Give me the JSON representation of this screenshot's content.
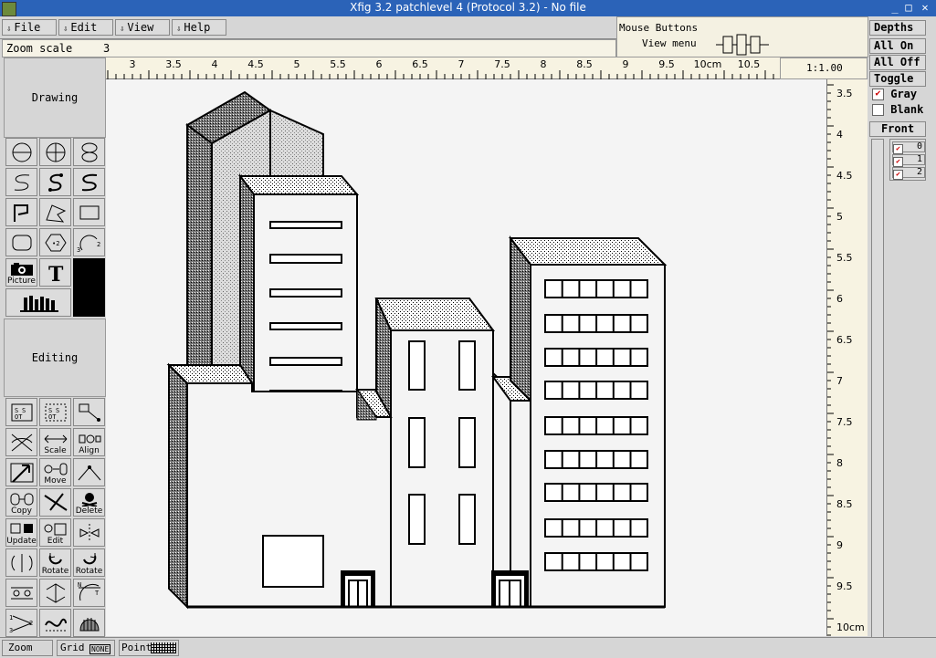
{
  "window": {
    "title": "Xfig 3.2 patchlevel 4 (Protocol 3.2) - No file"
  },
  "menu": {
    "items": [
      "File",
      "Edit",
      "View",
      "Help"
    ]
  },
  "zoom": {
    "label": "Zoom scale",
    "value": "3"
  },
  "mouse": {
    "title": "Mouse Buttons",
    "hint": "View menu"
  },
  "scale_readout": "1:1.00",
  "ruler": {
    "top_ticks": [
      "3",
      "3.5",
      "4",
      "4.5",
      "5",
      "5.5",
      "6",
      "6.5",
      "7",
      "7.5",
      "8",
      "8.5",
      "9",
      "9.5",
      "10cm",
      "10.5"
    ],
    "right_ticks": [
      "3.5",
      "4",
      "4.5",
      "5",
      "5.5",
      "6",
      "6.5",
      "7",
      "7.5",
      "8",
      "8.5",
      "9",
      "9.5",
      "10cm"
    ]
  },
  "modes": {
    "drawing": "Drawing",
    "editing": "Editing"
  },
  "tools": {
    "picture": "Picture",
    "scale": "Scale",
    "align": "Align",
    "move": "Move",
    "copy": "Copy",
    "delete": "Delete",
    "update": "Update",
    "edit": "Edit",
    "rotate_ccw": "Rotate",
    "rotate_cw": "Rotate"
  },
  "depths": {
    "title": "Depths",
    "all_on": "All On",
    "all_off": "All Off",
    "toggle": "Toggle",
    "gray": "Gray",
    "blank": "Blank",
    "front": "Front",
    "layers": [
      "0",
      "1",
      "2"
    ]
  },
  "status": {
    "zoom": "Zoom",
    "grid": "Grid",
    "grid_value": "NONE",
    "point": "Point"
  },
  "colors": {
    "titlebar": "#2b63b8",
    "canvas": "#f4f4f4",
    "ruler": "#f7f3e2",
    "panel": "#d6d6d6",
    "check": "#cc0000"
  }
}
